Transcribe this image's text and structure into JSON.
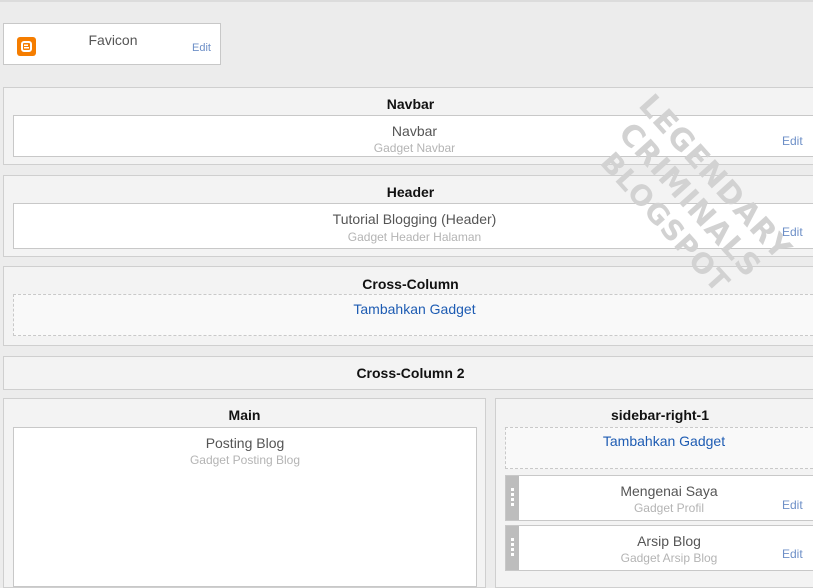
{
  "favicon": {
    "title": "Favicon",
    "edit": "Edit",
    "icon": "blogger-icon",
    "icon_color": "#f57d00"
  },
  "navbar": {
    "title": "Navbar",
    "gadget": {
      "title": "Navbar",
      "subtitle": "Gadget Navbar",
      "edit": "Edit"
    }
  },
  "header": {
    "title": "Header",
    "gadget": {
      "title": "Tutorial Blogging (Header)",
      "subtitle": "Gadget Header Halaman",
      "edit": "Edit"
    }
  },
  "cross_column": {
    "title": "Cross-Column",
    "add_gadget": "Tambahkan Gadget"
  },
  "cross_column_2": {
    "title": "Cross-Column 2"
  },
  "main": {
    "title": "Main",
    "gadget": {
      "title": "Posting Blog",
      "subtitle": "Gadget Posting Blog"
    }
  },
  "sidebar": {
    "title": "sidebar-right-1",
    "add_gadget": "Tambahkan Gadget",
    "gadgets": [
      {
        "title": "Mengenai Saya",
        "subtitle": "Gadget Profil",
        "edit": "Edit"
      },
      {
        "title": "Arsip Blog",
        "subtitle": "Gadget Arsip Blog",
        "edit": "Edit"
      }
    ]
  },
  "watermark": {
    "line1": "LEGENDARY CRIMINALS",
    "line2": "BLOGSPOT"
  },
  "colors": {
    "link": "#1e5cb3",
    "edit": "#6d8fc7",
    "background": "#ececec"
  }
}
